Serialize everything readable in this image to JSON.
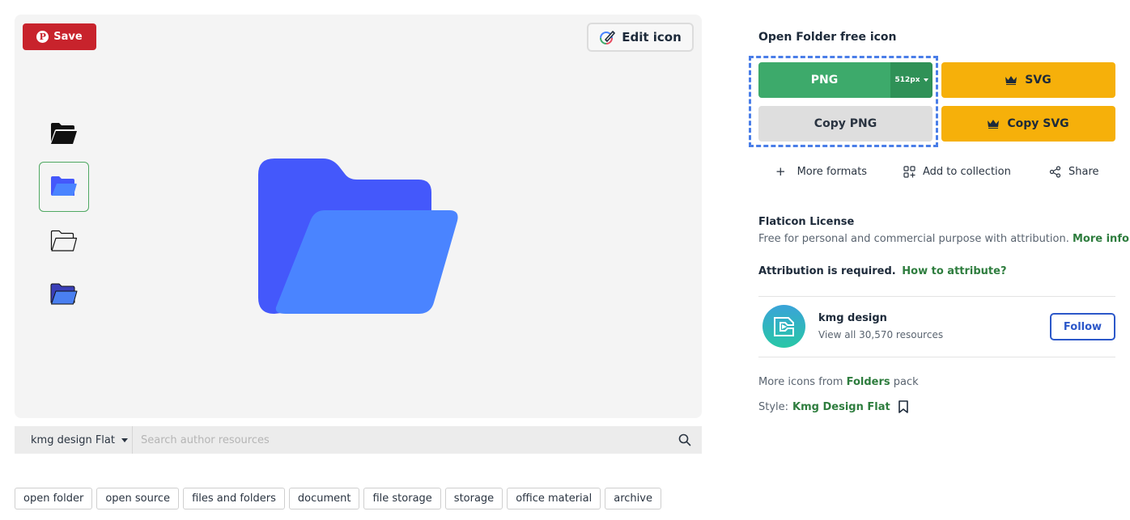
{
  "preview": {
    "save_label": "Save",
    "edit_label": "Edit icon",
    "thumbnails": [
      "folder-black-solid",
      "folder-blue-flat",
      "folder-outline",
      "folder-blue-outline"
    ]
  },
  "search": {
    "author_option": "kmg design Flat",
    "placeholder": "Search author resources"
  },
  "tags": [
    "open folder",
    "open source",
    "files and folders",
    "document",
    "file storage",
    "storage",
    "office material",
    "archive"
  ],
  "panel": {
    "title": "Open Folder free icon",
    "png_label": "PNG",
    "png_size": "512px",
    "svg_label": "SVG",
    "copy_png_label": "Copy PNG",
    "copy_svg_label": "Copy SVG",
    "more_formats": "More formats",
    "add_collection": "Add to collection",
    "share": "Share"
  },
  "license": {
    "title": "Flaticon License",
    "description": "Free for personal and commercial purpose with attribution.",
    "more_info": "More info",
    "attribution": "Attribution is required.",
    "how_to": "How to attribute?"
  },
  "author": {
    "name": "kmg design",
    "resources": "View all 30,570 resources",
    "follow_label": "Follow"
  },
  "pack": {
    "prefix": "More icons from",
    "name": "Folders",
    "suffix": "pack"
  },
  "style": {
    "label": "Style:",
    "name": "Kmg Design Flat"
  },
  "colors": {
    "png_green": "#3daa6b",
    "premium_yellow": "#f6b00a",
    "save_red": "#c8232c",
    "link_green": "#2e7d3e",
    "follow_blue": "#2c58c9",
    "folder_back": "#4458fb",
    "folder_front": "#4a84ff"
  }
}
